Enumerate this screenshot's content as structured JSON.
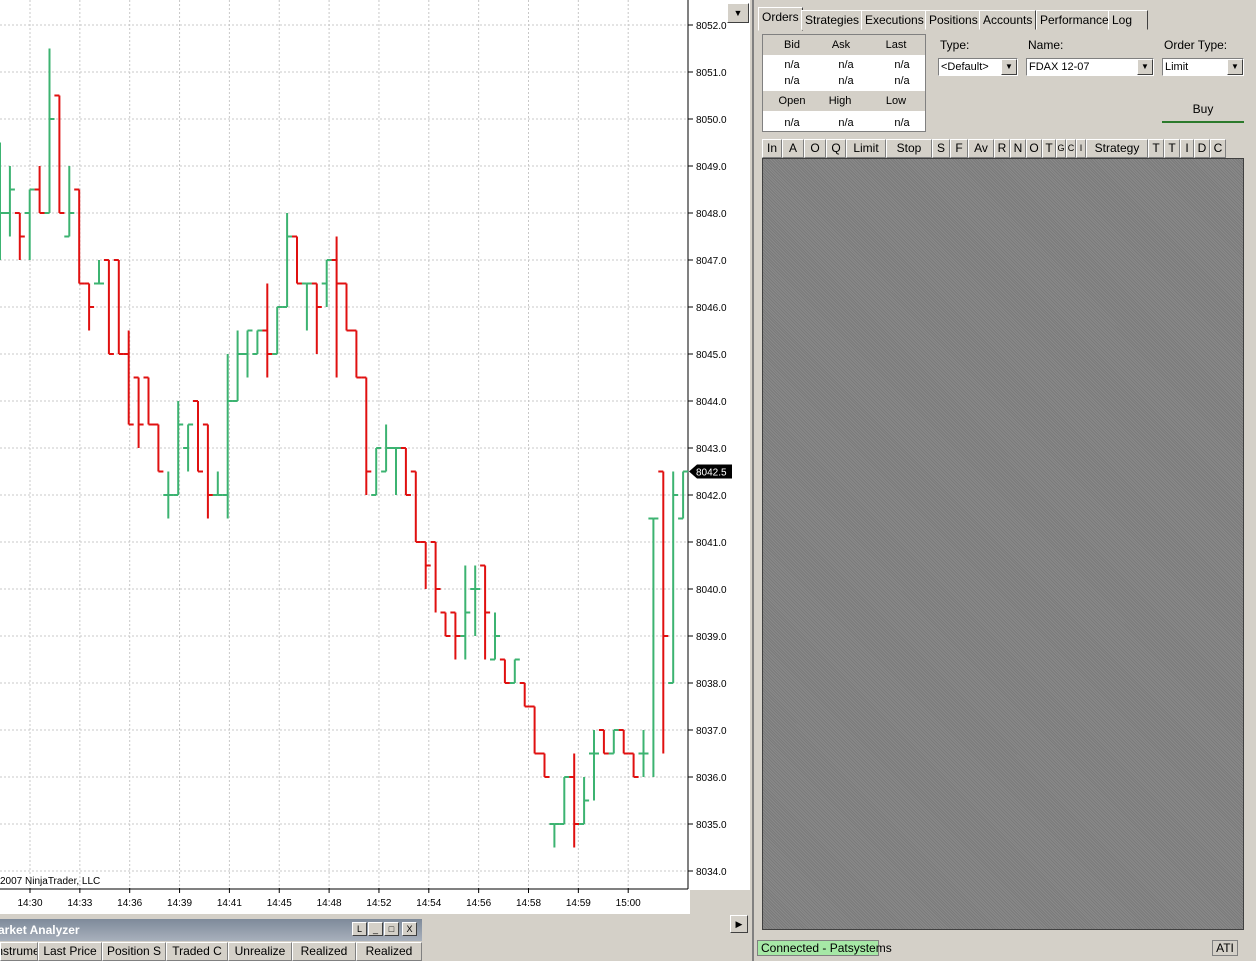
{
  "chart": {
    "copyright": "2007 NinjaTrader, LLC",
    "current_price_label": "8042.5",
    "price_ticks": [
      "8052.0",
      "8051.0",
      "8050.0",
      "8049.0",
      "8048.0",
      "8047.0",
      "8046.0",
      "8045.0",
      "8044.0",
      "8043.0",
      "8042.0",
      "8041.0",
      "8040.0",
      "8039.0",
      "8038.0",
      "8037.0",
      "8036.0",
      "8035.0",
      "8034.0"
    ],
    "time_ticks": [
      "14:30",
      "14:33",
      "14:36",
      "14:39",
      "14:41",
      "14:45",
      "14:48",
      "14:52",
      "14:54",
      "14:56",
      "14:58",
      "14:59",
      "15:00"
    ],
    "colors": {
      "up": "#3cb371",
      "down": "#e01010",
      "grid": "#c8c8c8"
    }
  },
  "chart_data": {
    "type": "ohlc",
    "title": "",
    "xlabel": "",
    "ylabel": "",
    "ylim": [
      8034.0,
      8052.0
    ],
    "bars": [
      {
        "o": 8048.0,
        "h": 8049.5,
        "l": 8047.0,
        "c": 8048.0
      },
      {
        "o": 8048.0,
        "h": 8049.0,
        "l": 8047.5,
        "c": 8048.5
      },
      {
        "o": 8048.0,
        "h": 8048.0,
        "l": 8047.0,
        "c": 8047.5
      },
      {
        "o": 8048.0,
        "h": 8048.5,
        "l": 8047.0,
        "c": 8048.5
      },
      {
        "o": 8048.5,
        "h": 8049.0,
        "l": 8048.0,
        "c": 8048.0
      },
      {
        "o": 8048.0,
        "h": 8051.5,
        "l": 8048.0,
        "c": 8050.0
      },
      {
        "o": 8050.5,
        "h": 8050.5,
        "l": 8048.0,
        "c": 8048.0
      },
      {
        "o": 8047.5,
        "h": 8049.0,
        "l": 8047.5,
        "c": 8048.0
      },
      {
        "o": 8048.5,
        "h": 8048.5,
        "l": 8046.5,
        "c": 8046.5
      },
      {
        "o": 8046.5,
        "h": 8046.5,
        "l": 8045.5,
        "c": 8046.0
      },
      {
        "o": 8046.5,
        "h": 8047.0,
        "l": 8046.5,
        "c": 8046.5
      },
      {
        "o": 8047.0,
        "h": 8047.0,
        "l": 8045.0,
        "c": 8045.0
      },
      {
        "o": 8047.0,
        "h": 8047.0,
        "l": 8045.0,
        "c": 8045.0
      },
      {
        "o": 8045.0,
        "h": 8045.5,
        "l": 8043.5,
        "c": 8043.5
      },
      {
        "o": 8044.5,
        "h": 8044.5,
        "l": 8043.0,
        "c": 8043.5
      },
      {
        "o": 8044.5,
        "h": 8044.5,
        "l": 8043.5,
        "c": 8043.5
      },
      {
        "o": 8043.5,
        "h": 8043.5,
        "l": 8042.5,
        "c": 8042.5
      },
      {
        "o": 8042.0,
        "h": 8042.5,
        "l": 8041.5,
        "c": 8042.0
      },
      {
        "o": 8042.0,
        "h": 8044.0,
        "l": 8042.0,
        "c": 8043.5
      },
      {
        "o": 8043.0,
        "h": 8043.5,
        "l": 8042.5,
        "c": 8043.5
      },
      {
        "o": 8044.0,
        "h": 8044.0,
        "l": 8042.5,
        "c": 8042.5
      },
      {
        "o": 8043.5,
        "h": 8043.5,
        "l": 8041.5,
        "c": 8042.0
      },
      {
        "o": 8042.0,
        "h": 8042.5,
        "l": 8042.0,
        "c": 8042.0
      },
      {
        "o": 8042.0,
        "h": 8045.0,
        "l": 8041.5,
        "c": 8044.0
      },
      {
        "o": 8044.0,
        "h": 8045.5,
        "l": 8044.0,
        "c": 8045.0
      },
      {
        "o": 8045.0,
        "h": 8045.5,
        "l": 8044.5,
        "c": 8045.5
      },
      {
        "o": 8045.0,
        "h": 8045.5,
        "l": 8045.0,
        "c": 8045.5
      },
      {
        "o": 8045.5,
        "h": 8046.5,
        "l": 8044.5,
        "c": 8045.0
      },
      {
        "o": 8045.0,
        "h": 8046.0,
        "l": 8045.0,
        "c": 8046.0
      },
      {
        "o": 8046.0,
        "h": 8048.0,
        "l": 8046.0,
        "c": 8047.5
      },
      {
        "o": 8047.5,
        "h": 8047.5,
        "l": 8046.5,
        "c": 8046.5
      },
      {
        "o": 8046.5,
        "h": 8046.5,
        "l": 8045.5,
        "c": 8046.5
      },
      {
        "o": 8046.5,
        "h": 8046.5,
        "l": 8045.0,
        "c": 8046.0
      },
      {
        "o": 8046.5,
        "h": 8047.0,
        "l": 8046.0,
        "c": 8047.0
      },
      {
        "o": 8047.0,
        "h": 8047.5,
        "l": 8044.5,
        "c": 8046.5
      },
      {
        "o": 8046.5,
        "h": 8046.5,
        "l": 8045.5,
        "c": 8045.5
      },
      {
        "o": 8045.5,
        "h": 8045.5,
        "l": 8044.5,
        "c": 8044.5
      },
      {
        "o": 8044.5,
        "h": 8044.5,
        "l": 8042.0,
        "c": 8042.5
      },
      {
        "o": 8042.0,
        "h": 8043.0,
        "l": 8042.0,
        "c": 8043.0
      },
      {
        "o": 8042.5,
        "h": 8043.5,
        "l": 8042.5,
        "c": 8043.0
      },
      {
        "o": 8043.0,
        "h": 8043.0,
        "l": 8042.0,
        "c": 8043.0
      },
      {
        "o": 8043.0,
        "h": 8043.0,
        "l": 8042.0,
        "c": 8042.0
      },
      {
        "o": 8042.5,
        "h": 8042.5,
        "l": 8041.0,
        "c": 8041.0
      },
      {
        "o": 8041.0,
        "h": 8041.0,
        "l": 8040.0,
        "c": 8040.5
      },
      {
        "o": 8041.0,
        "h": 8041.0,
        "l": 8039.5,
        "c": 8040.0
      },
      {
        "o": 8039.5,
        "h": 8039.5,
        "l": 8039.0,
        "c": 8039.0
      },
      {
        "o": 8039.5,
        "h": 8039.5,
        "l": 8038.5,
        "c": 8039.0
      },
      {
        "o": 8039.0,
        "h": 8040.5,
        "l": 8038.5,
        "c": 8039.5
      },
      {
        "o": 8040.0,
        "h": 8040.5,
        "l": 8039.0,
        "c": 8040.0
      },
      {
        "o": 8040.5,
        "h": 8040.5,
        "l": 8038.5,
        "c": 8039.5
      },
      {
        "o": 8038.5,
        "h": 8039.5,
        "l": 8038.5,
        "c": 8039.0
      },
      {
        "o": 8038.5,
        "h": 8038.5,
        "l": 8038.0,
        "c": 8038.0
      },
      {
        "o": 8038.0,
        "h": 8038.5,
        "l": 8038.0,
        "c": 8038.5
      },
      {
        "o": 8038.0,
        "h": 8038.0,
        "l": 8037.5,
        "c": 8037.5
      },
      {
        "o": 8037.5,
        "h": 8037.5,
        "l": 8036.5,
        "c": 8036.5
      },
      {
        "o": 8036.5,
        "h": 8036.5,
        "l": 8036.0,
        "c": 8036.0
      },
      {
        "o": 8035.0,
        "h": 8035.0,
        "l": 8034.5,
        "c": 8035.0
      },
      {
        "o": 8035.0,
        "h": 8036.0,
        "l": 8035.0,
        "c": 8036.0
      },
      {
        "o": 8036.0,
        "h": 8036.5,
        "l": 8034.5,
        "c": 8035.0
      },
      {
        "o": 8035.0,
        "h": 8036.0,
        "l": 8035.0,
        "c": 8035.5
      },
      {
        "o": 8036.5,
        "h": 8037.0,
        "l": 8035.5,
        "c": 8036.5
      },
      {
        "o": 8037.0,
        "h": 8037.0,
        "l": 8036.5,
        "c": 8036.5
      },
      {
        "o": 8036.5,
        "h": 8037.0,
        "l": 8036.5,
        "c": 8037.0
      },
      {
        "o": 8037.0,
        "h": 8037.0,
        "l": 8036.5,
        "c": 8036.5
      },
      {
        "o": 8036.5,
        "h": 8036.5,
        "l": 8036.0,
        "c": 8036.0
      },
      {
        "o": 8036.5,
        "h": 8037.0,
        "l": 8036.0,
        "c": 8036.5
      },
      {
        "o": 8041.5,
        "h": 8041.5,
        "l": 8036.0,
        "c": 8041.5
      },
      {
        "o": 8042.5,
        "h": 8042.5,
        "l": 8036.5,
        "c": 8039.0
      },
      {
        "o": 8038.0,
        "h": 8042.5,
        "l": 8038.0,
        "c": 8042.0
      },
      {
        "o": 8041.5,
        "h": 8042.5,
        "l": 8041.5,
        "c": 8042.5
      }
    ]
  },
  "right_panel": {
    "tabs": [
      "Orders",
      "Strategies",
      "Executions",
      "Positions",
      "Accounts",
      "Performance",
      "Log"
    ],
    "quote": {
      "headers1": [
        "Bid",
        "Ask",
        "Last"
      ],
      "row1": [
        "n/a",
        "n/a",
        "n/a"
      ],
      "row2": [
        "n/a",
        "n/a",
        "n/a"
      ],
      "headers2": [
        "Open",
        "High",
        "Low"
      ],
      "row3": [
        "n/a",
        "n/a",
        "n/a"
      ]
    },
    "order": {
      "type_label": "Type:",
      "type_value": "<Default>",
      "name_label": "Name:",
      "name_value": "FDAX 12-07",
      "order_type_label": "Order Type:",
      "order_type_value": "Limit",
      "buy_label": "Buy"
    },
    "grid_columns": [
      "In",
      "A",
      "O",
      "Q",
      "Limit",
      "Stop",
      "S",
      "F",
      "Av",
      "R",
      "N",
      "O",
      "T",
      "G",
      "C",
      "I",
      "Strategy",
      "T",
      "T",
      "I",
      "D",
      "C"
    ],
    "status_connected": "Connected - Patsystems",
    "status_ati": "ATI"
  },
  "market_analyzer": {
    "title": "Market Analyzer",
    "buttons": [
      "L",
      "_",
      "□",
      "X"
    ],
    "columns": [
      "Instrumen",
      "Last Price",
      "Position S",
      "Traded C",
      "Unrealize",
      "Realized",
      "Realized"
    ]
  }
}
